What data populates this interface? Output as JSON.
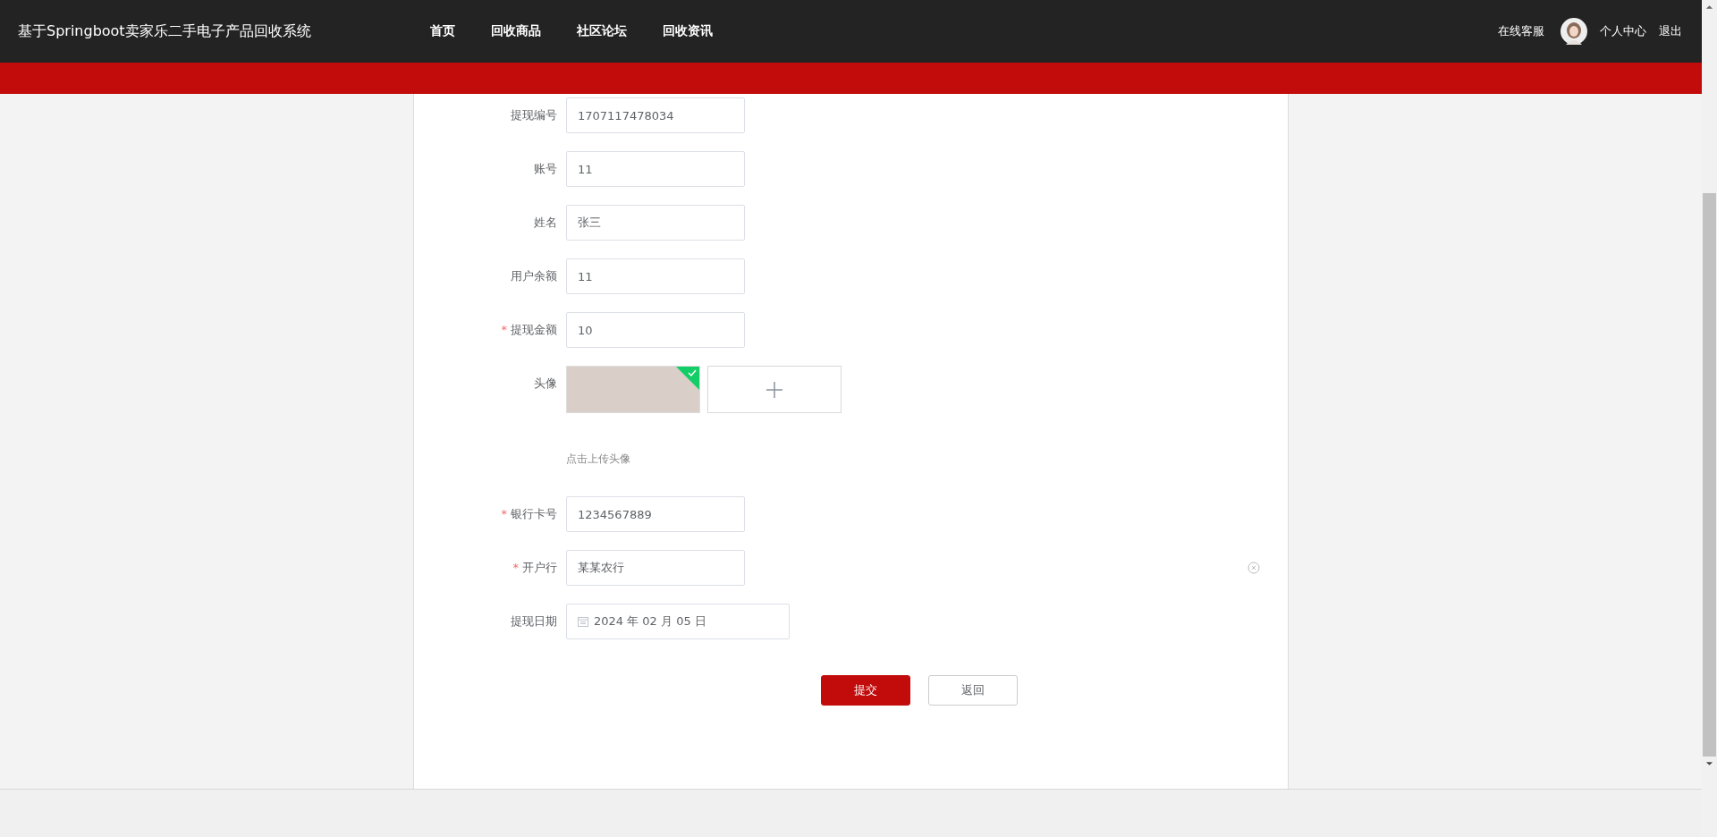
{
  "header": {
    "title": "基于Springboot卖家乐二手电子产品回收系统",
    "nav": [
      {
        "label": "首页"
      },
      {
        "label": "回收商品"
      },
      {
        "label": "社区论坛"
      },
      {
        "label": "回收资讯"
      }
    ],
    "service": "在线客服",
    "profile": "个人中心",
    "logout": "退出"
  },
  "form": {
    "required_mark": "*",
    "fields": [
      {
        "kind": "text",
        "label": "提现编号",
        "required": false,
        "value": "1707117478034"
      },
      {
        "kind": "text",
        "label": "账号",
        "required": false,
        "value": "11"
      },
      {
        "kind": "text",
        "label": "姓名",
        "required": false,
        "value": "张三"
      },
      {
        "kind": "text",
        "label": "用户余额",
        "required": false,
        "value": "11"
      },
      {
        "kind": "text",
        "label": "提现金额",
        "required": true,
        "value": "10"
      },
      {
        "kind": "image",
        "label": "头像",
        "required": false,
        "uploaded": true,
        "hint": "点击上传头像"
      },
      {
        "kind": "text",
        "label": "银行卡号",
        "required": true,
        "value": "1234567889"
      },
      {
        "kind": "text",
        "label": "开户行",
        "required": true,
        "value": "某某农行",
        "clear_icon": true
      },
      {
        "kind": "date",
        "label": "提现日期",
        "required": false,
        "value": "2024 年 02 月 05 日"
      }
    ],
    "buttons": [
      {
        "kind": "primary",
        "label": "提交"
      },
      {
        "kind": "default",
        "label": "返回"
      }
    ]
  }
}
